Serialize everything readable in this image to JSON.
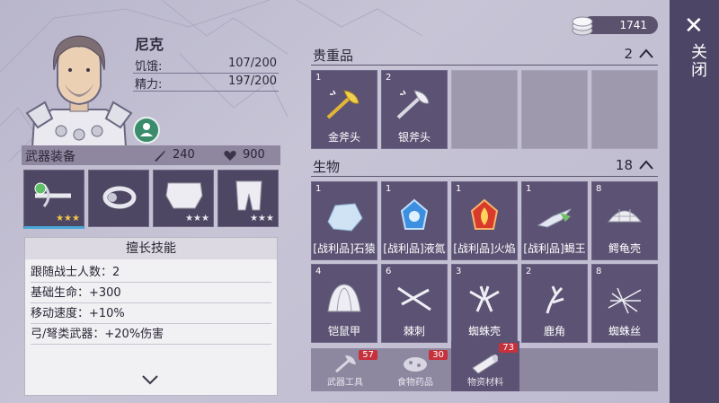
{
  "colors": {
    "panel": "#5c5374",
    "empty_slot": "#9e99ad",
    "accent_blue": "#4aa7d8",
    "badge_red": "#c6313b",
    "close_strip": "#4c4566"
  },
  "currency": {
    "icon": "coin-stack-icon",
    "value": "1741"
  },
  "close": {
    "icon": "close-icon",
    "label": "关闭"
  },
  "character": {
    "name": "尼克",
    "hunger_label": "饥饿:",
    "hunger_value": "107/200",
    "energy_label": "精力:",
    "energy_value": "197/200"
  },
  "equipment": {
    "title": "武器装备",
    "attack": "240",
    "health": "900",
    "slots": [
      {
        "icon": "crossbow-icon",
        "stars": "★★★",
        "selected": true
      },
      {
        "icon": "ring-icon",
        "stars": "",
        "selected": false
      },
      {
        "icon": "chest-armor-icon",
        "stars": "★★★",
        "selected": false
      },
      {
        "icon": "leg-armor-icon",
        "stars": "★★★",
        "selected": false
      }
    ]
  },
  "skills": {
    "title": "擅长技能",
    "rows": [
      "跟随战士人数：2",
      "基础生命：+300",
      "移动速度：+10%",
      "弓/弩类武器：+20%伤害"
    ]
  },
  "valuables": {
    "title": "贵重品",
    "count": "2",
    "items": [
      {
        "count": "1",
        "name": "金斧头",
        "icon": "gold-axe-icon"
      },
      {
        "count": "2",
        "name": "银斧头",
        "icon": "silver-axe-icon"
      }
    ]
  },
  "creatures": {
    "title": "生物",
    "count": "18",
    "items": [
      {
        "count": "1",
        "name": "[战利品]石猿",
        "icon": "crystal-rock-icon"
      },
      {
        "count": "1",
        "name": "[战利品]液氮",
        "icon": "blue-gem-icon"
      },
      {
        "count": "1",
        "name": "[战利品]火焰",
        "icon": "fire-gem-icon"
      },
      {
        "count": "1",
        "name": "[战利品]蝎王",
        "icon": "scorpion-icon"
      },
      {
        "count": "8",
        "name": "鳄龟壳",
        "icon": "turtle-shell-icon"
      },
      {
        "count": "4",
        "name": "铠鼠甲",
        "icon": "armadillo-shell-icon"
      },
      {
        "count": "6",
        "name": "棘刺",
        "icon": "thorn-icon"
      },
      {
        "count": "3",
        "name": "蜘蛛壳",
        "icon": "spider-shell-icon"
      },
      {
        "count": "2",
        "name": "鹿角",
        "icon": "antler-icon"
      },
      {
        "count": "8",
        "name": "蜘蛛丝",
        "icon": "spider-silk-icon"
      }
    ]
  },
  "tabs": [
    {
      "label": "武器工具",
      "badge": "57",
      "icon": "axe-tool-icon",
      "active": false
    },
    {
      "label": "食物药品",
      "badge": "30",
      "icon": "food-icon",
      "active": false
    },
    {
      "label": "物资材料",
      "badge": "73",
      "icon": "material-icon",
      "active": true
    }
  ]
}
